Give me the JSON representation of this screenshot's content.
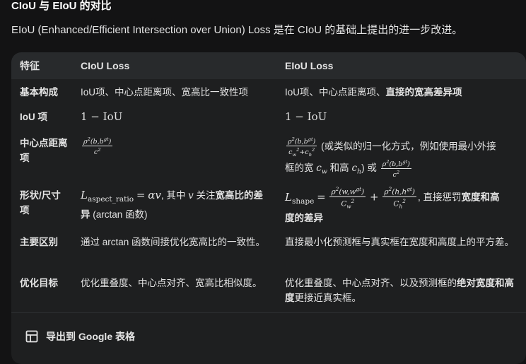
{
  "heading": "CIoU 与 EIoU 的对比",
  "intro": "EIoU (Enhanced/Efficient Intersection over Union) Loss 是在 CIoU 的基础上提出的进一步改进。",
  "table": {
    "headers": [
      "特征",
      "CIoU Loss",
      "EIoU Loss"
    ],
    "rows": [
      {
        "feature": "基本构成",
        "ciou": "IoU项、中心点距离项、宽高比一致性项",
        "eiou_prefix": "IoU项、中心点距离项、",
        "eiou_bold": "直接的宽高差异项"
      },
      {
        "feature": "IoU 项",
        "ciou": "1 − IoU",
        "eiou": "1 − IoU"
      },
      {
        "feature": "中心点距离项",
        "ciou_num": "ρ²(b,b^gt)",
        "ciou_den": "c²",
        "eiou_text1": "(或类似的归一化方式，例如使用最小外接",
        "eiou_text2": "框的宽",
        "eiou_cw": "c_w",
        "eiou_text3": "和高",
        "eiou_ch": "c_h",
        "eiou_text4": ") 或"
      },
      {
        "feature": "形状/尺寸项",
        "ciou_text1": ", 其中",
        "ciou_text2": "关注",
        "ciou_bold": "宽高比的差异",
        "ciou_text3": "(arctan 函数)",
        "eiou_text1": ", 直接惩罚",
        "eiou_bold1": "宽度和高",
        "eiou_bold2": "度的差异"
      },
      {
        "feature": "主要区别",
        "ciou": "通过 arctan 函数间接优化宽高比的一致性。",
        "eiou": "直接最小化预测框与真实框在宽度和高度上的平方差。"
      },
      {
        "feature": "优化目标",
        "ciou": "优化重叠度、中心点对齐、宽高比相似度。",
        "eiou_prefix": "优化重叠度、中心点对齐、以及预测框的",
        "eiou_bold": "绝对宽度和高度",
        "eiou_suffix": "更接近真实框。"
      }
    ]
  },
  "export": {
    "label": "导出到 Google 表格",
    "icon": "table-grid-icon"
  }
}
